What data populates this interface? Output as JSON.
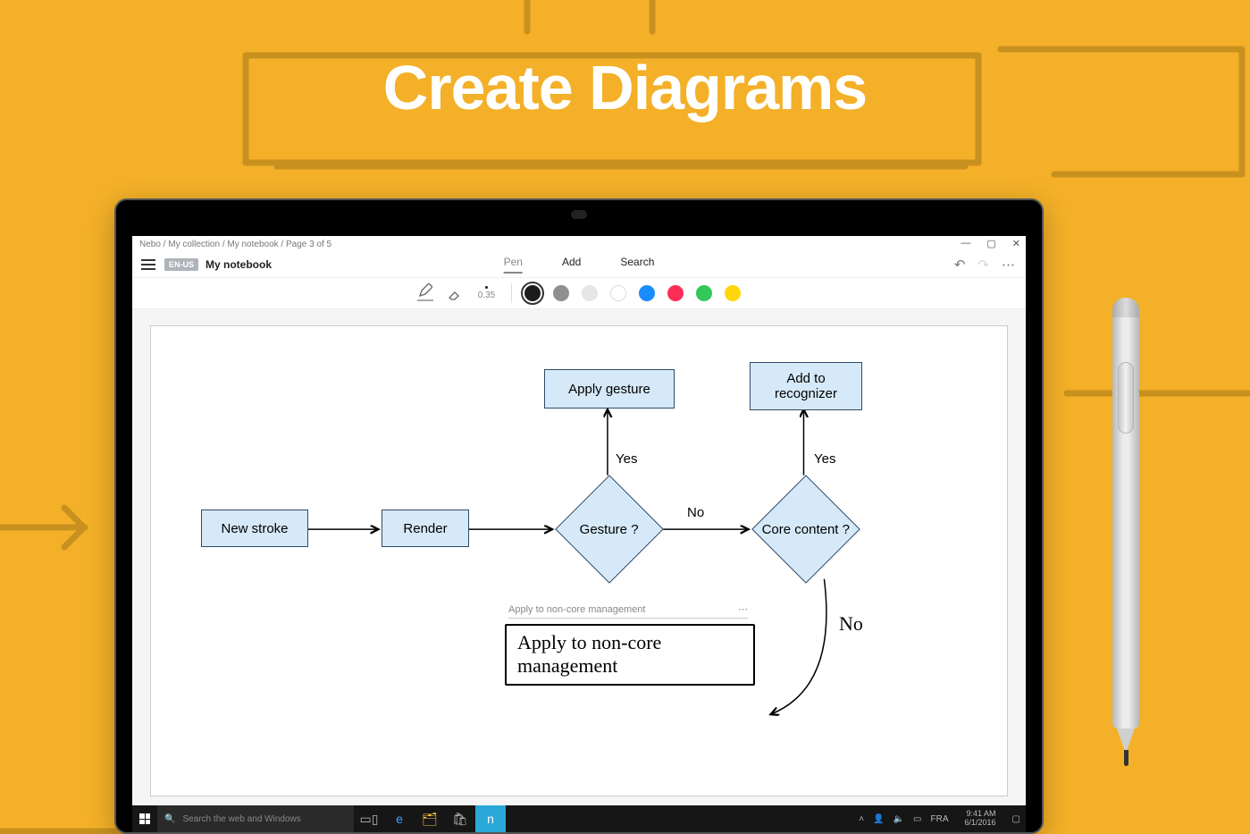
{
  "hero": {
    "title": "Create Diagrams"
  },
  "breadcrumb": "Nebo  /  My collection  /  My notebook /  Page 3 of 5",
  "window": {
    "minimize": "—",
    "maximize": "▢",
    "close": "✕"
  },
  "header": {
    "lang_badge": "EN-US",
    "notebook_name": "My notebook",
    "tabs": {
      "pen": "Pen",
      "add": "Add",
      "search": "Search"
    },
    "undo": "↶",
    "redo": "↷",
    "more": "⋯"
  },
  "tools": {
    "size_label": "0.35",
    "colors": [
      {
        "name": "black",
        "hex": "#1b1b1b",
        "selected": true
      },
      {
        "name": "gray",
        "hex": "#8f8f8f",
        "selected": false
      },
      {
        "name": "lightgray",
        "hex": "#e6e6e6",
        "selected": false
      },
      {
        "name": "white",
        "hex": "#ffffff",
        "selected": false
      },
      {
        "name": "blue",
        "hex": "#1a8cff",
        "selected": false
      },
      {
        "name": "red",
        "hex": "#ff2d55",
        "selected": false
      },
      {
        "name": "green",
        "hex": "#34c759",
        "selected": false
      },
      {
        "name": "yellow",
        "hex": "#ffd60a",
        "selected": false
      }
    ]
  },
  "flow": {
    "new_stroke": "New stroke",
    "render": "Render",
    "gesture_q": "Gesture ?",
    "apply_gesture": "Apply gesture",
    "core_content_q": "Core content ?",
    "add_recognizer_l1": "Add to",
    "add_recognizer_l2": "recognizer",
    "yes1": "Yes",
    "no1": "No",
    "yes2": "Yes",
    "no2": "No",
    "hint_text": "Apply to non-core management",
    "hint_more": "⋯",
    "handwritten": "Apply to non-core\nmanagement"
  },
  "taskbar": {
    "search_placeholder": "Search the web and Windows",
    "tray_lang": "FRA",
    "time": "9:41 AM",
    "date": "6/1/2016"
  }
}
